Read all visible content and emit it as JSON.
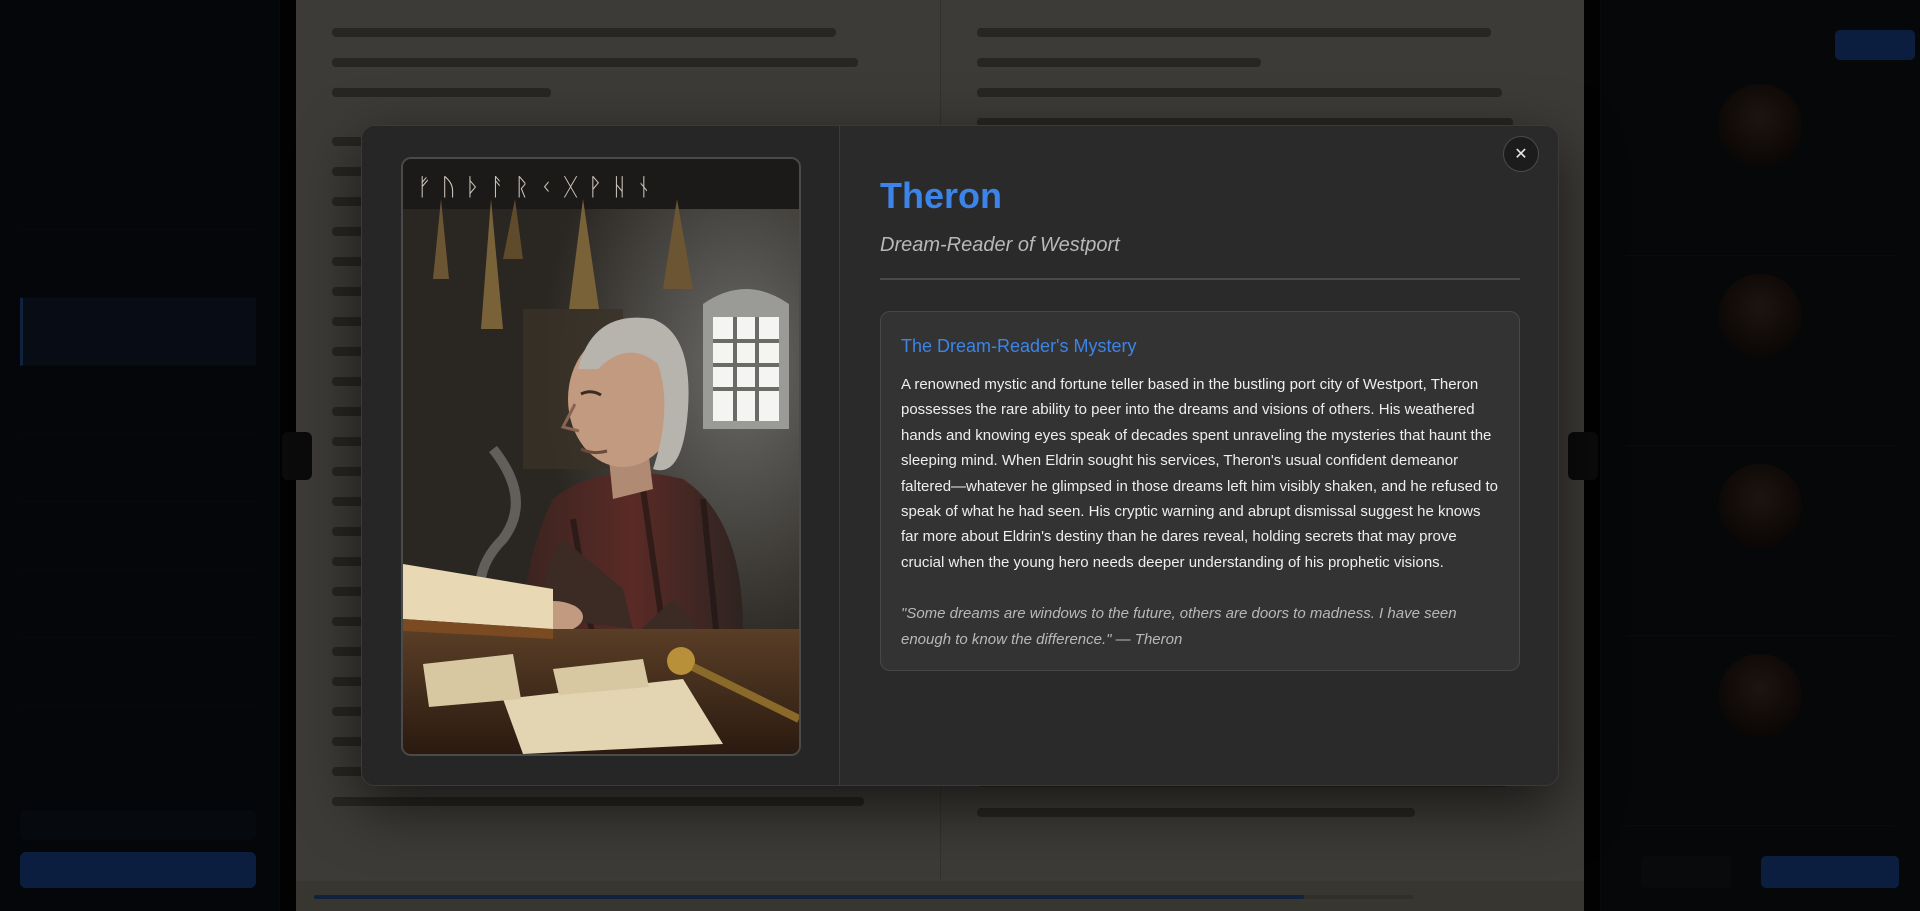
{
  "modal": {
    "title": "Theron",
    "subtitle": "Dream-Reader of Westport",
    "close_label": "✕",
    "story_heading": "The Dream-Reader's Mystery",
    "story_body": "A renowned mystic and fortune teller based in the bustling port city of Westport, Theron possesses the rare ability to peer into the dreams and visions of others. His weathered hands and knowing eyes speak of decades spent unraveling the mysteries that haunt the sleeping mind. When Eldrin sought his services, Theron's usual confident demeanor faltered—whatever he glimpsed in those dreams left him visibly shaken, and he refused to speak of what he had seen. His cryptic warning and abrupt dismissal suggest he knows far more about Eldrin's destiny than he dares reveal, holding secrets that may prove crucial when the young hero needs deeper understanding of his prophetic visions.",
    "quote": "\"Some dreams are windows to the future, others are doors to madness. I have seen enough to know the difference.\" — Theron",
    "portrait_runes": "ᚠᚢᚦᚨᚱᚲᚷᚹᚺᚾ"
  },
  "background": {
    "progress_fraction": 0.9
  },
  "colors": {
    "accent": "#3d84e8",
    "modal_bg": "#2a2a2a",
    "overlay": "rgba(0,0,0,0.72)"
  }
}
